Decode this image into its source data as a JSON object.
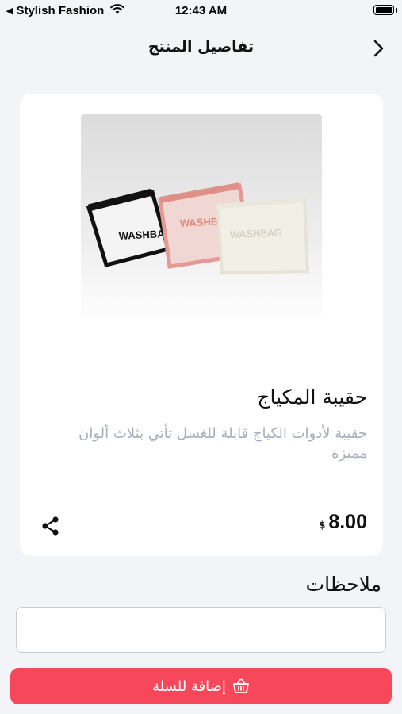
{
  "status_bar": {
    "carrier": "Stylish Fashion",
    "time": "12:43 AM"
  },
  "header": {
    "title": "تفاصيل المنتج"
  },
  "product": {
    "image_labels": [
      "WASHBAG",
      "WASHBAG",
      "WASHBAG"
    ],
    "name": "حقيبة المكياج",
    "description": "حقيبة لأدوات الكياج قابلة للغسل تأتي بثلاث ألوان مميزة",
    "price": "8.00",
    "currency": "$"
  },
  "notes": {
    "label": "ملاحظات",
    "value": "",
    "placeholder": ""
  },
  "actions": {
    "add_to_cart_label": "إضافة للسلة"
  },
  "colors": {
    "background": "#f2f4f7",
    "accent": "#f6485a",
    "muted_text": "#a9adbd"
  }
}
